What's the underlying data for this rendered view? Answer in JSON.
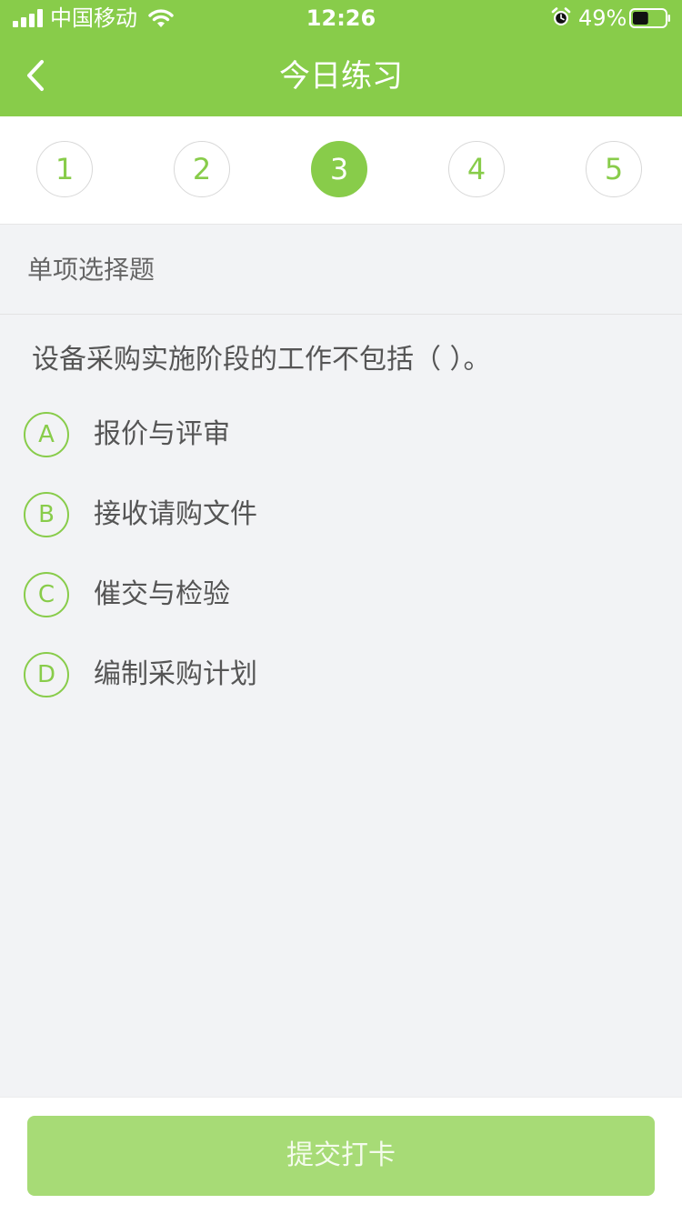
{
  "status_bar": {
    "carrier": "中国移动",
    "time": "12:26",
    "battery": "49%",
    "signal_icon": "signal-bars-icon",
    "wifi_icon": "wifi-icon",
    "alarm_icon": "alarm-clock-icon",
    "battery_icon": "battery-icon",
    "battery_level": 0.49
  },
  "header": {
    "title": "今日练习",
    "back_icon": "chevron-left-icon"
  },
  "question_numbers": [
    {
      "label": "1",
      "active": false
    },
    {
      "label": "2",
      "active": false
    },
    {
      "label": "3",
      "active": true
    },
    {
      "label": "4",
      "active": false
    },
    {
      "label": "5",
      "active": false
    }
  ],
  "section": {
    "title": "单项选择题"
  },
  "question": {
    "text": "设备采购实施阶段的工作不包括（    ）。",
    "options": [
      {
        "letter": "A",
        "text": "报价与评审"
      },
      {
        "letter": "B",
        "text": "接收请购文件"
      },
      {
        "letter": "C",
        "text": "催交与检验"
      },
      {
        "letter": "D",
        "text": "编制采购计划"
      }
    ]
  },
  "footer": {
    "submit_label": "提交打卡"
  },
  "colors": {
    "accent": "#88cc4a",
    "button_disabled": "#a7db76",
    "background": "#f2f3f5"
  }
}
